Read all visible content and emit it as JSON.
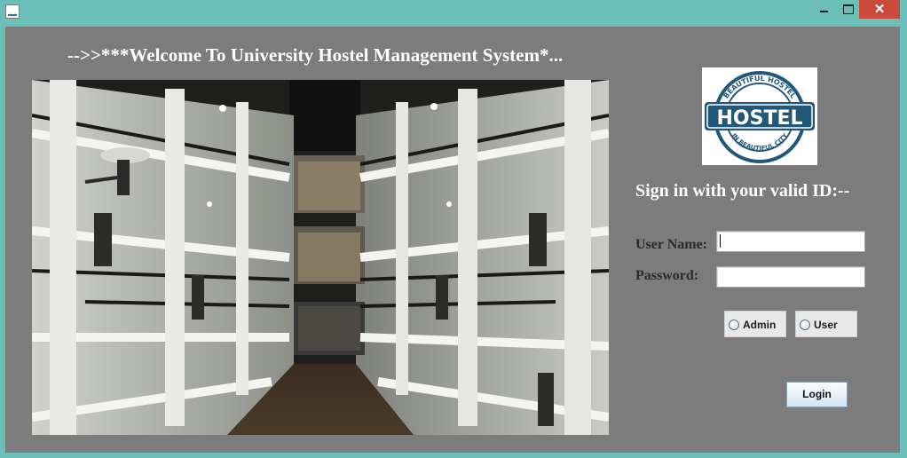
{
  "window": {
    "close_glyph": "✕",
    "icons": {
      "app": "java-icon",
      "minimize": "minimize-icon",
      "maximize": "maximize-icon",
      "close": "close-icon"
    }
  },
  "main": {
    "welcome_text": "-->>***Welcome To University Hostel Management System*...",
    "photo_subject": "hostel-corridor-photo",
    "logo": {
      "icon": "hostel-logo",
      "ring_top": "BEAUTIFUL HOSTEL",
      "center_word": "HOSTEL",
      "ring_bottom": "IN BEAUTIFUL CITY"
    },
    "signin_heading": "Sign in with your valid ID:--",
    "username_label": "User Name:",
    "username_value": "",
    "password_label": "Password:",
    "password_value": "",
    "role_options": [
      {
        "label": "Admin",
        "selected": false
      },
      {
        "label": "User",
        "selected": false
      }
    ],
    "login_label": "Login"
  },
  "colors": {
    "frame": "#6cbfb8",
    "panel": "#7c7c7c",
    "close_button": "#c94a3c",
    "logo_blue": "#22577a",
    "heading_text": "#ffffff"
  }
}
